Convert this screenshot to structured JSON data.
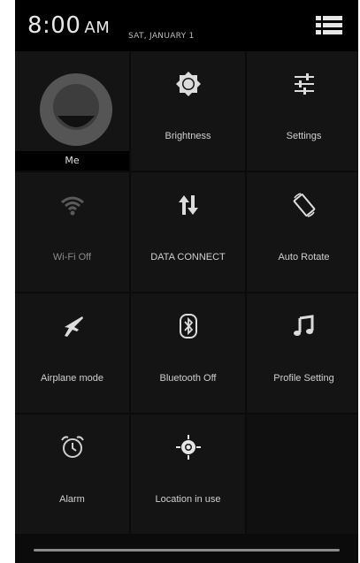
{
  "status": {
    "time": "8:00",
    "ampm": "AM",
    "date": "SAT, JANUARY 1"
  },
  "profile": {
    "label": "Me"
  },
  "tiles": [
    {
      "label": "Brightness",
      "icon": "brightness-icon"
    },
    {
      "label": "Settings",
      "icon": "settings-sliders-icon"
    },
    {
      "label": "Wi-Fi Off",
      "icon": "wifi-icon"
    },
    {
      "label": "DATA CONNECT",
      "icon": "data-arrows-icon"
    },
    {
      "label": "Auto Rotate",
      "icon": "auto-rotate-icon"
    },
    {
      "label": "Airplane mode",
      "icon": "airplane-icon"
    },
    {
      "label": "Bluetooth Off",
      "icon": "bluetooth-icon"
    },
    {
      "label": "Profile Setting",
      "icon": "music-note-icon"
    },
    {
      "label": "Alarm",
      "icon": "alarm-clock-icon"
    },
    {
      "label": "Location in use",
      "icon": "location-icon"
    }
  ],
  "colors": {
    "background": "#000000",
    "tile": "#141414",
    "text": "#d0d0d0"
  }
}
